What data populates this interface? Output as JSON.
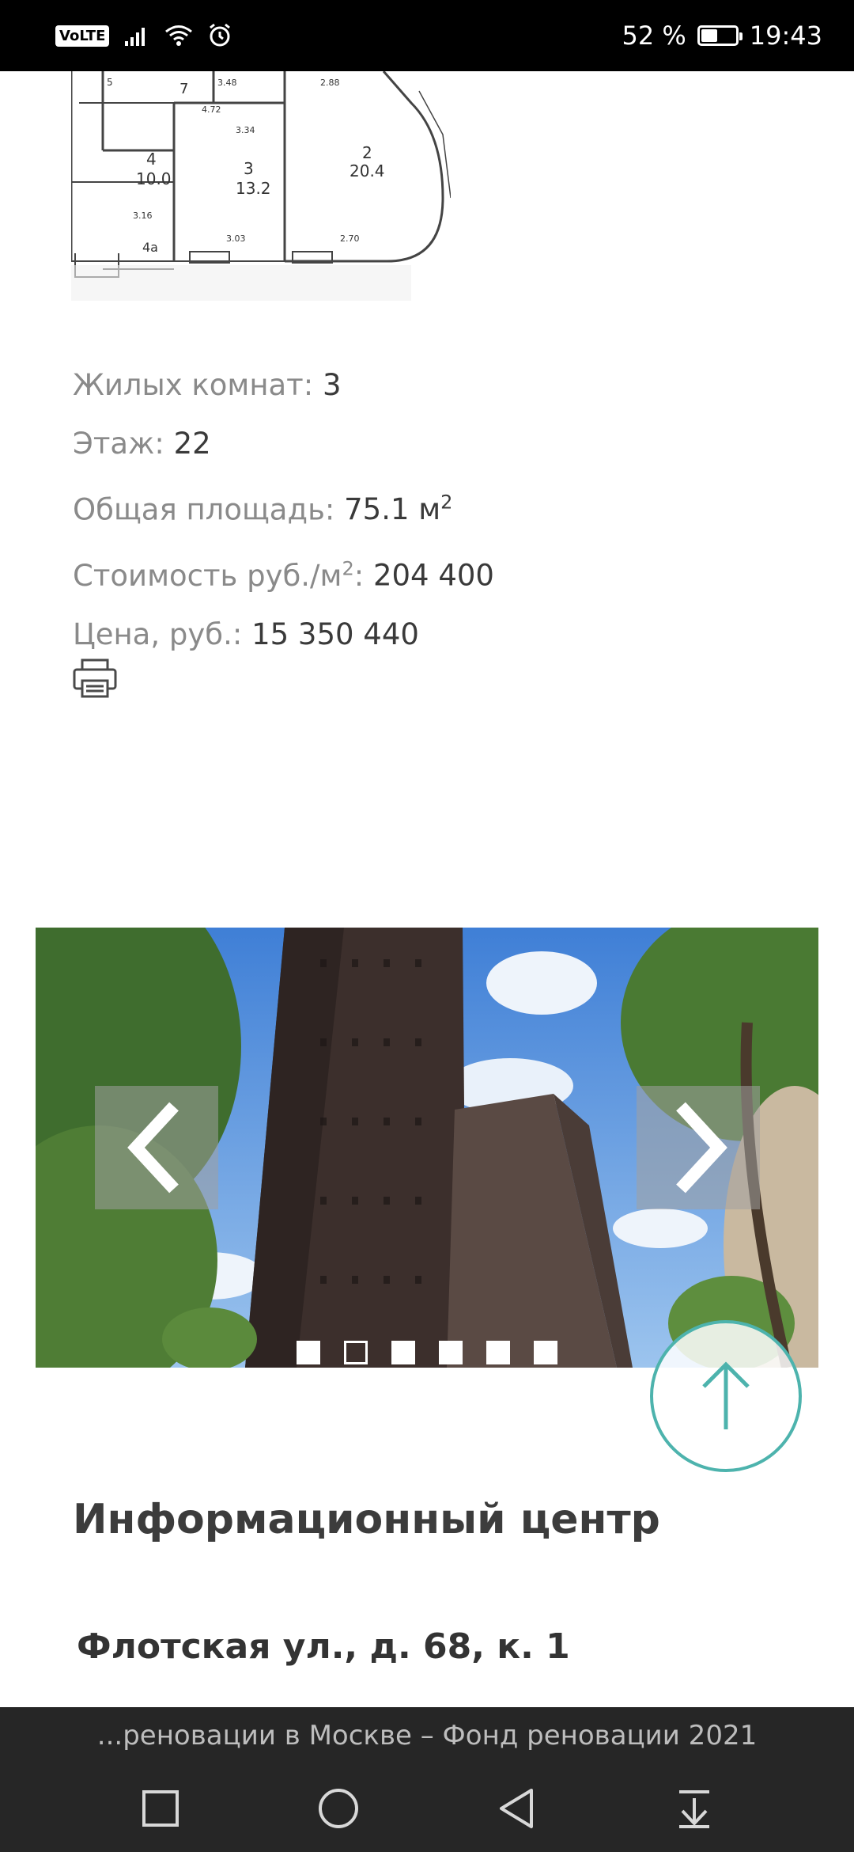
{
  "status_bar": {
    "volte": "VoLTE",
    "battery": "52 %",
    "battery_level": 0.52,
    "time": "19:43"
  },
  "floorplan": {
    "labels": [
      "7",
      "3.48",
      "2.88",
      "4.72",
      "3.34",
      "4",
      "10.0",
      "3",
      "13.2",
      "2",
      "20.4",
      "3.03",
      "2.70",
      "4a",
      "3.16"
    ]
  },
  "info": {
    "rooms_label": "Жилых комнат:",
    "rooms_value": "3",
    "floor_label": "Этаж:",
    "floor_value": "22",
    "area_label": "Общая площадь:",
    "area_value": "75.1 м",
    "area_sup": "2",
    "price_m2_label_a": "Стоимость руб./м",
    "price_m2_sup": "2",
    "price_m2_label_b": ":",
    "price_m2_value": "204 400",
    "price_label": "Цена, руб.:",
    "price_value": "15 350 440"
  },
  "carousel": {
    "slide_count": 6,
    "active_index": 1
  },
  "info_center": {
    "heading": "Информационный центр",
    "address": "Флотская ул., д. 68, к. 1"
  },
  "browser": {
    "page_title": "...реновации в Москве – Фонд реновации 2021"
  },
  "colors": {
    "accent": "#4db3ad",
    "system_bar": "#262626"
  }
}
